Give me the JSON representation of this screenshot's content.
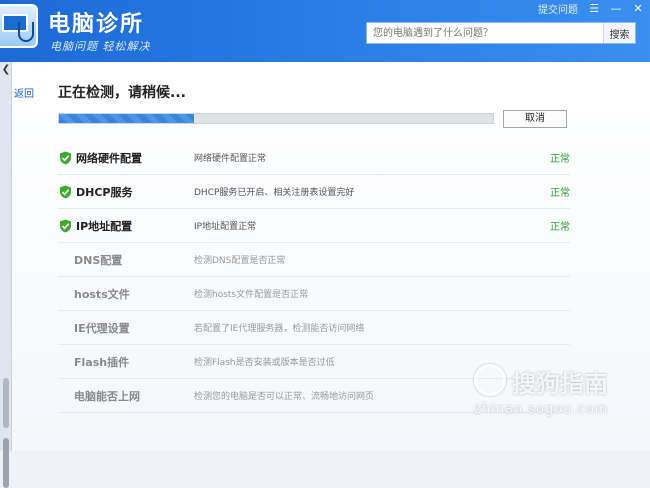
{
  "header": {
    "title": "电脑诊所",
    "subtitle": "电脑问题 轻松解决",
    "feedback": "提交问题",
    "search_placeholder": "您的电脑遇到了什么问题？",
    "search_button": "搜索"
  },
  "nav": {
    "back": "返回"
  },
  "status": {
    "title": "正在检测，请稍候...",
    "progress": 0.31,
    "cancel": "取消"
  },
  "items": [
    {
      "name": "网络硬件配置",
      "desc": "网络硬件配置正常",
      "status": "正常",
      "done": true
    },
    {
      "name": "DHCP服务",
      "desc": "DHCP服务已开启、相关注册表设置完好",
      "status": "正常",
      "done": true
    },
    {
      "name": "IP地址配置",
      "desc": "IP地址配置正常",
      "status": "正常",
      "done": true
    },
    {
      "name": "DNS配置",
      "desc": "检测DNS配置是否正常",
      "status": "",
      "done": false
    },
    {
      "name": "hosts文件",
      "desc": "检测hosts文件配置是否正常",
      "status": "",
      "done": false
    },
    {
      "name": "IE代理设置",
      "desc": "若配置了IE代理服务器，检测能否访问网络",
      "status": "",
      "done": false
    },
    {
      "name": "Flash插件",
      "desc": "检测Flash是否安装或版本是否过低",
      "status": "",
      "done": false
    },
    {
      "name": "电脑能否上网",
      "desc": "检测您的电脑是否可以正常、流畅地访问网页",
      "status": "",
      "done": false
    }
  ],
  "watermark": {
    "text": "搜狗指南",
    "url": "zhinan.sogou.com"
  },
  "colors": {
    "accent": "#2a7fe6",
    "ok": "#2ea02e",
    "check": "#3cab2c"
  }
}
